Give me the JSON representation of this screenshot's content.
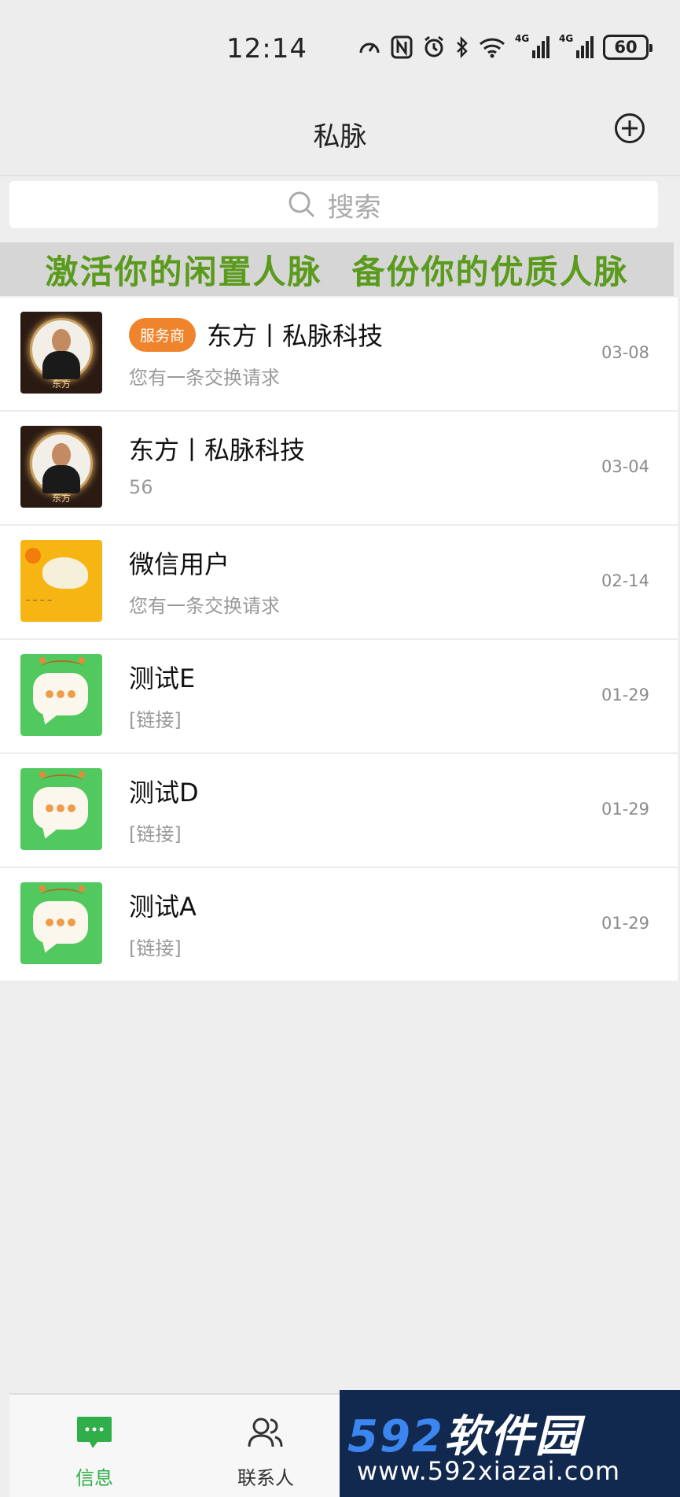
{
  "status_bar": {
    "time": "12:14",
    "network_1": "4G",
    "network_2": "4G",
    "battery": "60"
  },
  "header": {
    "title": "私脉"
  },
  "search": {
    "placeholder": "搜索"
  },
  "banner": {
    "left_text": "激活你的闲置人脉",
    "right_text": "备份你的优质人脉",
    "color": "#5a9a1c"
  },
  "chats": [
    {
      "name": "东方丨私脉科技",
      "badge": "服务商",
      "preview": "您有一条交换请求",
      "time": "03-08",
      "avatar_tag": "东方"
    },
    {
      "name": "东方丨私脉科技",
      "preview": "56",
      "time": "03-04",
      "avatar_tag": "东方"
    },
    {
      "name": "微信用户",
      "preview": "您有一条交换请求",
      "time": "02-14"
    },
    {
      "name": "测试E",
      "preview": "[链接]",
      "time": "01-29"
    },
    {
      "name": "测试D",
      "preview": "[链接]",
      "time": "01-29"
    },
    {
      "name": "测试A",
      "preview": "[链接]",
      "time": "01-29"
    }
  ],
  "tabs": [
    {
      "label": "信息",
      "icon": "message-icon",
      "active": true,
      "color": "#2fae4a"
    },
    {
      "label": "联系人",
      "icon": "contacts-icon",
      "active": false
    }
  ],
  "watermark": {
    "digits": "592",
    "brand": "软件园",
    "url": "www.592xiazai.com"
  }
}
